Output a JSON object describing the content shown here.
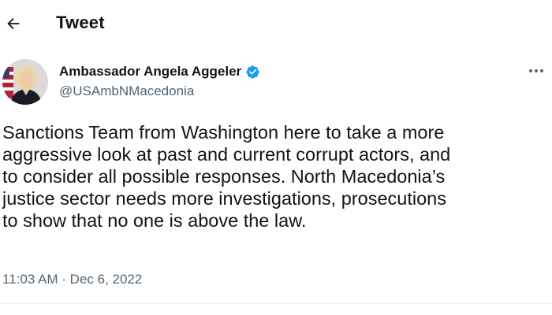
{
  "header": {
    "title": "Tweet",
    "back_icon": "arrow-left-icon"
  },
  "author": {
    "display_name": "Ambassador Angela Aggeler",
    "handle": "@USAmbNMacedonia",
    "verified": true,
    "verified_color": "#1d9bf0"
  },
  "tweet": {
    "lines": [
      "Sanctions Team from Washington here to take a more",
      "aggressive look at past and current corrupt actors, and",
      "to consider all possible responses. North Macedonia’s",
      "justice sector needs more investigations, prosecutions",
      "to show that no one is above the law."
    ],
    "timestamp": "11:03 AM · Dec 6, 2022"
  },
  "colors": {
    "text": "#0f1419",
    "secondary": "#536471",
    "accent": "#1d9bf0",
    "divider": "#eff3f4"
  }
}
